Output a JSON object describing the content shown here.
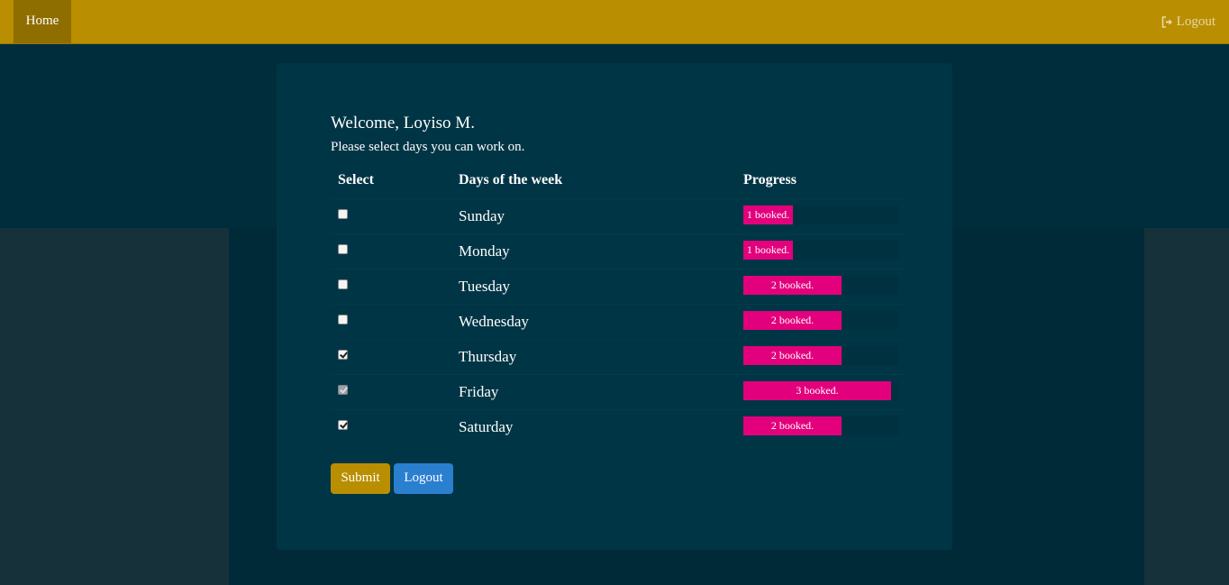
{
  "nav": {
    "home_label": "Home",
    "logout_label": "Logout"
  },
  "main": {
    "welcome": "Welcome, Loyiso M.",
    "instruction": "Please select days you can work on.",
    "headers": {
      "select": "Select",
      "days": "Days of the week",
      "progress": "Progress"
    },
    "rows": [
      {
        "day": "Sunday",
        "checked": false,
        "disabled": false,
        "progress_label": "1 booked.",
        "booked": 1
      },
      {
        "day": "Monday",
        "checked": false,
        "disabled": false,
        "progress_label": "1 booked.",
        "booked": 1
      },
      {
        "day": "Tuesday",
        "checked": false,
        "disabled": false,
        "progress_label": "2 booked.",
        "booked": 2
      },
      {
        "day": "Wednesday",
        "checked": false,
        "disabled": false,
        "progress_label": "2 booked.",
        "booked": 2
      },
      {
        "day": "Thursday",
        "checked": true,
        "disabled": false,
        "progress_label": "2 booked.",
        "booked": 2
      },
      {
        "day": "Friday",
        "checked": true,
        "disabled": true,
        "progress_label": "3 booked.",
        "booked": 3
      },
      {
        "day": "Saturday",
        "checked": true,
        "disabled": false,
        "progress_label": "2 booked.",
        "booked": 2
      }
    ],
    "progress_max": 3.15,
    "submit_label": "Submit",
    "logout_label": "Logout"
  },
  "colors": {
    "navbar": "#b98e00",
    "background": "#002d3b",
    "card": "#003545",
    "progress_bar": "#e2007c",
    "submit_button": "#b98e00",
    "logout_button": "#2a7fcf"
  }
}
